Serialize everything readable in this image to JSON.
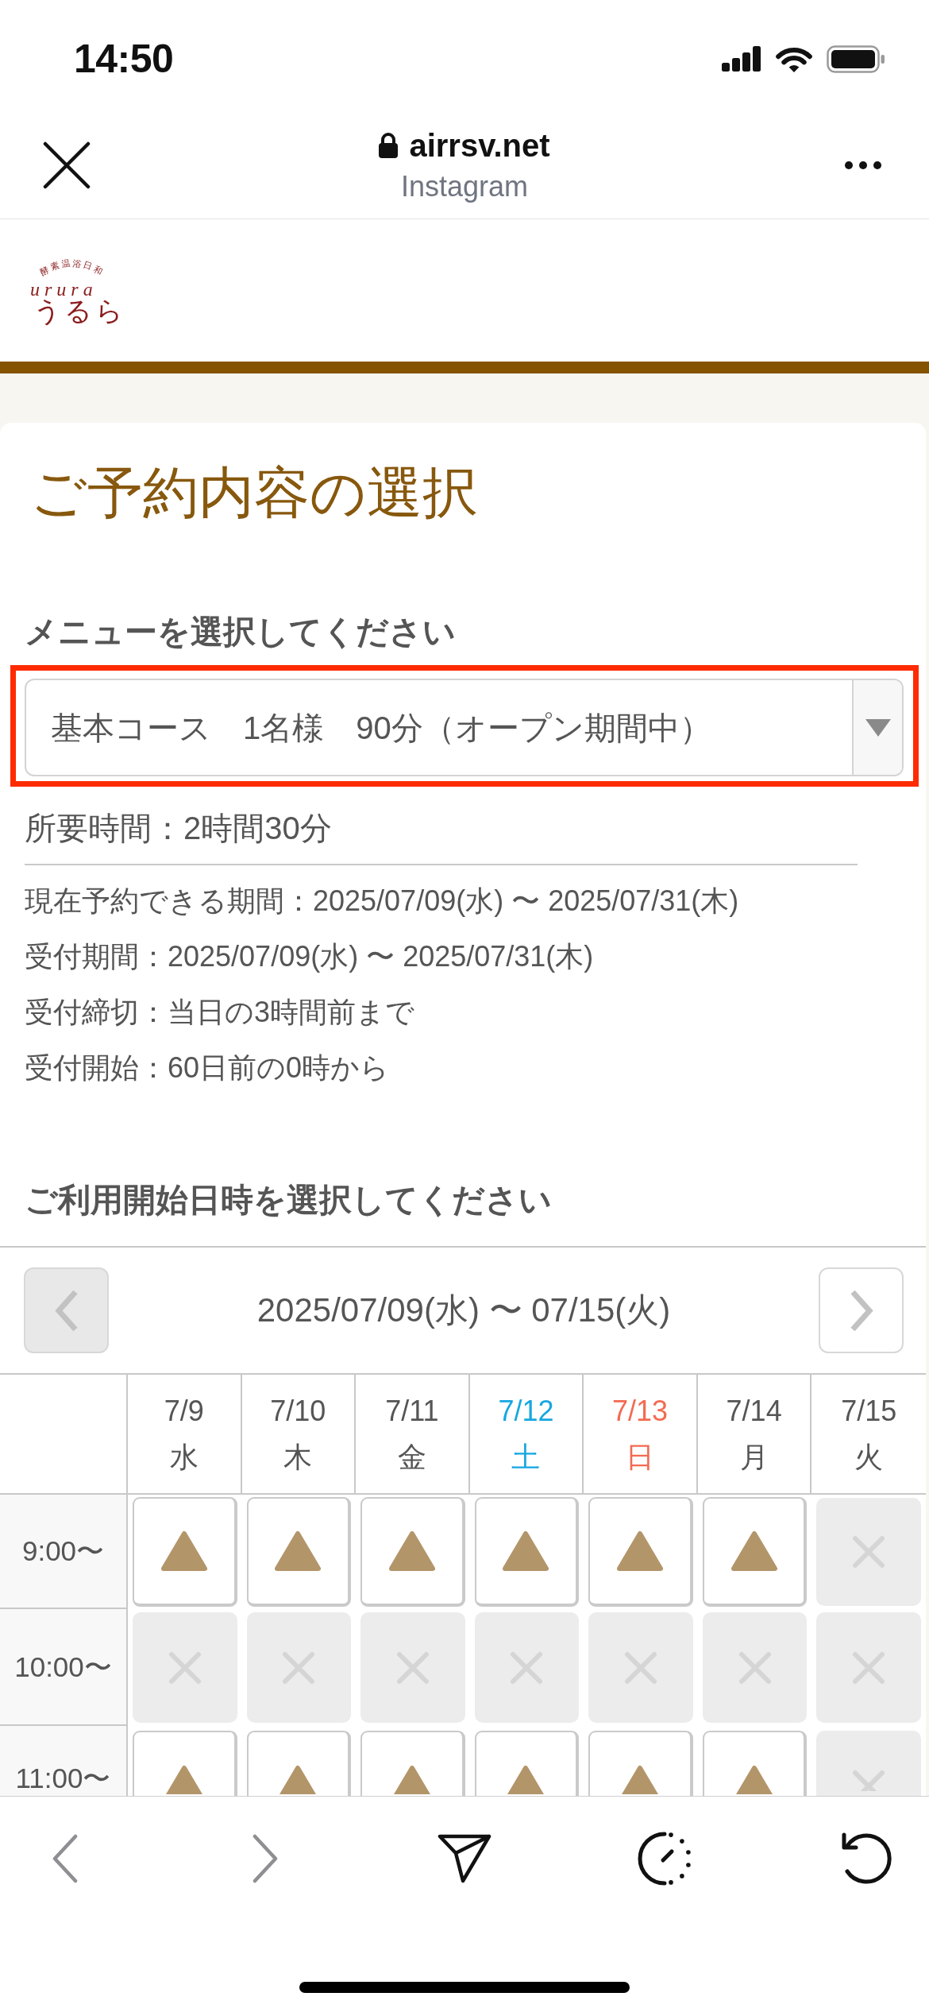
{
  "status_bar": {
    "time": "14:50"
  },
  "browser": {
    "domain": "airrsv.net",
    "source": "Instagram",
    "secure": true
  },
  "logo": {
    "tagline": "酵素温浴日和",
    "script": "urura",
    "name": "うるら"
  },
  "page": {
    "title": "ご予約内容の選択"
  },
  "menu": {
    "label": "メニューを選択してください",
    "value": "基本コース　1名様　90分（オープン期間中）",
    "highlighted": true,
    "duration": "所要時間：2時間30分",
    "details": [
      "現在予約できる期間：2025/07/09(水) 〜 2025/07/31(木)",
      "受付期間：2025/07/09(水) 〜 2025/07/31(木)",
      "受付締切：当日の3時間前まで",
      "受付開始：60日前の0時から"
    ]
  },
  "calendar": {
    "label": "ご利用開始日時を選択してください",
    "range": "2025/07/09(水) 〜 07/15(火)",
    "prev": {
      "disabled": true
    },
    "next": {
      "disabled": false
    },
    "days": [
      {
        "date": "7/9",
        "weekday": "水",
        "kind": "weekday"
      },
      {
        "date": "7/10",
        "weekday": "木",
        "kind": "weekday"
      },
      {
        "date": "7/11",
        "weekday": "金",
        "kind": "weekday"
      },
      {
        "date": "7/12",
        "weekday": "土",
        "kind": "saturday"
      },
      {
        "date": "7/13",
        "weekday": "日",
        "kind": "sunday"
      },
      {
        "date": "7/14",
        "weekday": "月",
        "kind": "weekday"
      },
      {
        "date": "7/15",
        "weekday": "火",
        "kind": "weekday"
      }
    ],
    "rows": [
      {
        "time": "9:00〜",
        "slots": [
          {
            "available": true
          },
          {
            "available": true
          },
          {
            "available": true
          },
          {
            "available": true
          },
          {
            "available": true
          },
          {
            "available": true
          },
          {
            "available": false
          }
        ]
      },
      {
        "time": "10:00〜",
        "slots": [
          {
            "available": false
          },
          {
            "available": false
          },
          {
            "available": false
          },
          {
            "available": false
          },
          {
            "available": false
          },
          {
            "available": false
          },
          {
            "available": false
          }
        ]
      },
      {
        "time": "11:00〜",
        "slots": [
          {
            "available": true
          },
          {
            "available": true
          },
          {
            "available": true
          },
          {
            "available": true
          },
          {
            "available": true
          },
          {
            "available": true
          },
          {
            "available": false
          }
        ]
      }
    ]
  },
  "toolbar": [
    {
      "kind": "back",
      "disabled": true
    },
    {
      "kind": "forward",
      "disabled": true
    },
    {
      "kind": "share",
      "disabled": false
    },
    {
      "kind": "timer",
      "disabled": false
    },
    {
      "kind": "reload",
      "disabled": false
    }
  ]
}
